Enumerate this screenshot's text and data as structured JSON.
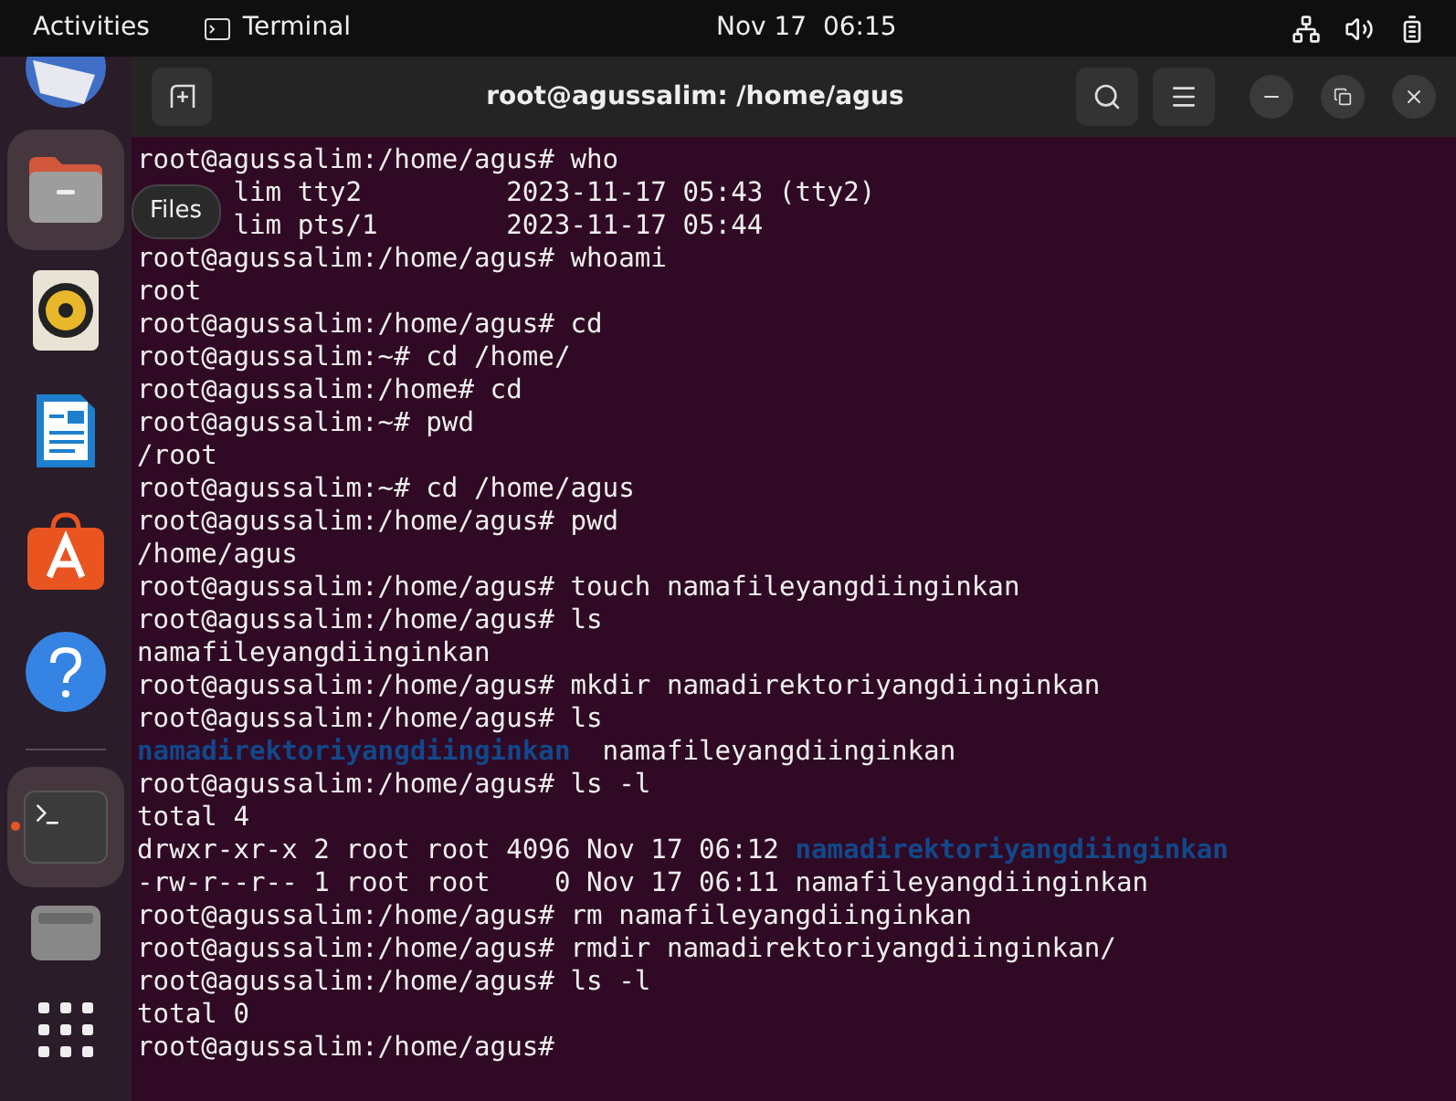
{
  "top_bar": {
    "activities": "Activities",
    "app_name": "Terminal",
    "clock": "Nov 17  06:15"
  },
  "dock": {
    "tooltip": "Files",
    "favorites": [
      {
        "kind": "mail",
        "selected": false,
        "running": false
      },
      {
        "kind": "files",
        "selected": true,
        "running": false
      },
      {
        "kind": "music",
        "selected": false,
        "running": false
      },
      {
        "kind": "writer",
        "selected": false,
        "running": false
      },
      {
        "kind": "store",
        "selected": false,
        "running": false
      },
      {
        "kind": "help",
        "selected": false,
        "running": false
      }
    ],
    "others": [
      {
        "kind": "terminal",
        "selected": true,
        "running": true
      },
      {
        "kind": "drive",
        "selected": false,
        "running": false
      }
    ]
  },
  "window": {
    "title": "root@agussalim: /home/agus"
  },
  "terminal": {
    "lines": [
      {
        "segments": [
          {
            "kind": "plain",
            "text": "root@agussalim:/home/agus# who"
          }
        ]
      },
      {
        "segments": [
          {
            "kind": "covered",
            "text": "lim tty2         2023-11-17 05:43 (tty2)"
          }
        ]
      },
      {
        "segments": [
          {
            "kind": "covered",
            "text": "lim pts/1        2023-11-17 05:44"
          }
        ]
      },
      {
        "segments": [
          {
            "kind": "plain",
            "text": "root@agussalim:/home/agus# whoami"
          }
        ]
      },
      {
        "segments": [
          {
            "kind": "plain",
            "text": "root"
          }
        ]
      },
      {
        "segments": [
          {
            "kind": "plain",
            "text": "root@agussalim:/home/agus# cd"
          }
        ]
      },
      {
        "segments": [
          {
            "kind": "plain",
            "text": "root@agussalim:~# cd /home/"
          }
        ]
      },
      {
        "segments": [
          {
            "kind": "plain",
            "text": "root@agussalim:/home# cd"
          }
        ]
      },
      {
        "segments": [
          {
            "kind": "plain",
            "text": "root@agussalim:~# pwd"
          }
        ]
      },
      {
        "segments": [
          {
            "kind": "plain",
            "text": "/root"
          }
        ]
      },
      {
        "segments": [
          {
            "kind": "plain",
            "text": "root@agussalim:~# cd /home/agus"
          }
        ]
      },
      {
        "segments": [
          {
            "kind": "plain",
            "text": "root@agussalim:/home/agus# pwd"
          }
        ]
      },
      {
        "segments": [
          {
            "kind": "plain",
            "text": "/home/agus"
          }
        ]
      },
      {
        "segments": [
          {
            "kind": "plain",
            "text": "root@agussalim:/home/agus# touch namafileyangdiinginkan"
          }
        ]
      },
      {
        "segments": [
          {
            "kind": "plain",
            "text": "root@agussalim:/home/agus# ls"
          }
        ]
      },
      {
        "segments": [
          {
            "kind": "plain",
            "text": "namafileyangdiinginkan"
          }
        ]
      },
      {
        "segments": [
          {
            "kind": "plain",
            "text": "root@agussalim:/home/agus# mkdir namadirektoriyangdiinginkan"
          }
        ]
      },
      {
        "segments": [
          {
            "kind": "plain",
            "text": "root@agussalim:/home/agus# ls"
          }
        ]
      },
      {
        "segments": [
          {
            "kind": "dir",
            "text": "namadirektoriyangdiinginkan"
          },
          {
            "kind": "plain",
            "text": "  namafileyangdiinginkan"
          }
        ]
      },
      {
        "segments": [
          {
            "kind": "plain",
            "text": "root@agussalim:/home/agus# ls -l"
          }
        ]
      },
      {
        "segments": [
          {
            "kind": "plain",
            "text": "total 4"
          }
        ]
      },
      {
        "segments": [
          {
            "kind": "plain",
            "text": "drwxr-xr-x 2 root root 4096 Nov 17 06:12 "
          },
          {
            "kind": "dir",
            "text": "namadirektoriyangdiinginkan"
          }
        ]
      },
      {
        "segments": [
          {
            "kind": "plain",
            "text": "-rw-r--r-- 1 root root    0 Nov 17 06:11 namafileyangdiinginkan"
          }
        ]
      },
      {
        "segments": [
          {
            "kind": "plain",
            "text": "root@agussalim:/home/agus# rm namafileyangdiinginkan"
          }
        ]
      },
      {
        "segments": [
          {
            "kind": "plain",
            "text": "root@agussalim:/home/agus# rmdir namadirektoriyangdiinginkan/"
          }
        ]
      },
      {
        "segments": [
          {
            "kind": "plain",
            "text": "root@agussalim:/home/agus# ls -l"
          }
        ]
      },
      {
        "segments": [
          {
            "kind": "plain",
            "text": "total 0"
          }
        ]
      },
      {
        "segments": [
          {
            "kind": "plain",
            "text": "root@agussalim:/home/agus#"
          }
        ]
      }
    ]
  }
}
